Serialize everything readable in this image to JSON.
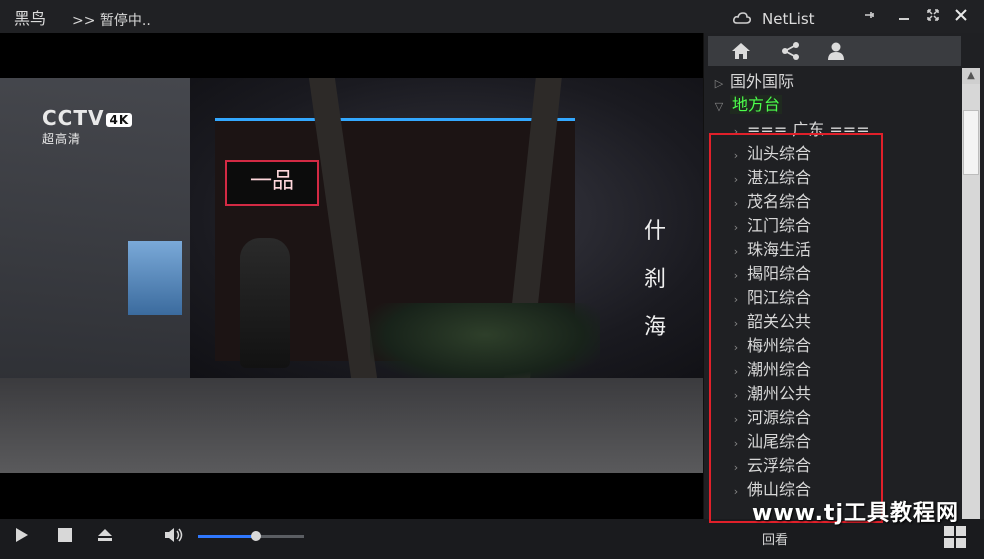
{
  "titlebar": {
    "app_name": "黑鸟",
    "status": ">> 暂停中..",
    "panel_title": "NetList"
  },
  "video": {
    "channel_logo": "CCTV",
    "channel_badge": "4K",
    "channel_sub": "超高清",
    "sign_text": "一品",
    "place_name": "什刹海"
  },
  "panel": {
    "toolbar_icons": [
      "home-icon",
      "share-icon",
      "user-icon"
    ],
    "tree": [
      {
        "label": "国外国际",
        "expanded": false
      },
      {
        "label": "地方台",
        "expanded": true,
        "selected": true
      }
    ],
    "channels": [
      "=== 广东 ===",
      "汕头综合",
      "湛江综合",
      "茂名综合",
      "江门综合",
      "珠海生活",
      "揭阳综合",
      "阳江综合",
      "韶关公共",
      "梅州综合",
      "潮州综合",
      "潮州公共",
      "河源综合",
      "汕尾综合",
      "云浮综合",
      "佛山综合"
    ]
  },
  "controls": {
    "volume_level": 0.55,
    "replay_label": "回看"
  },
  "watermark": "www.tj工具教程网",
  "colors": {
    "accent": "#2f78ff",
    "selected_text": "#4cff4c",
    "highlight_border": "#e0202a"
  }
}
